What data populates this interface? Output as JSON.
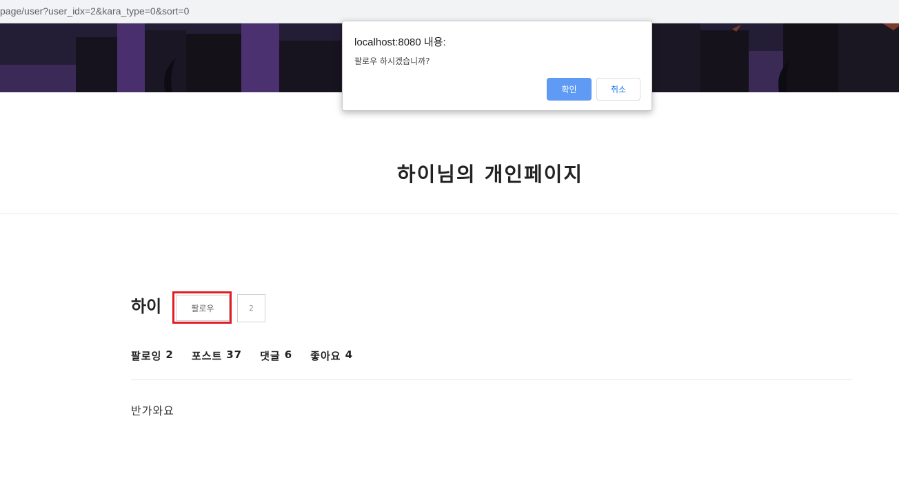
{
  "browser": {
    "url": "page/user?user_idx=2&kara_type=0&sort=0"
  },
  "page": {
    "title": "하이님의 개인페이지"
  },
  "profile": {
    "username": "하이",
    "follow_label": "팔로우",
    "follower_count": "2",
    "stats": [
      {
        "label": "팔로잉",
        "value": "2"
      },
      {
        "label": "포스트",
        "value": "37"
      },
      {
        "label": "댓글",
        "value": "6"
      },
      {
        "label": "좋아요",
        "value": "4"
      }
    ],
    "bio": "반가와요"
  },
  "dialog": {
    "title": "localhost:8080 내용:",
    "message": "팔로우 하시겠습니까?",
    "ok_label": "확인",
    "cancel_label": "취소"
  },
  "colors": {
    "highlight": "#e01b24",
    "ok_button": "#5f9bf5",
    "cancel_text": "#1a73e8"
  }
}
